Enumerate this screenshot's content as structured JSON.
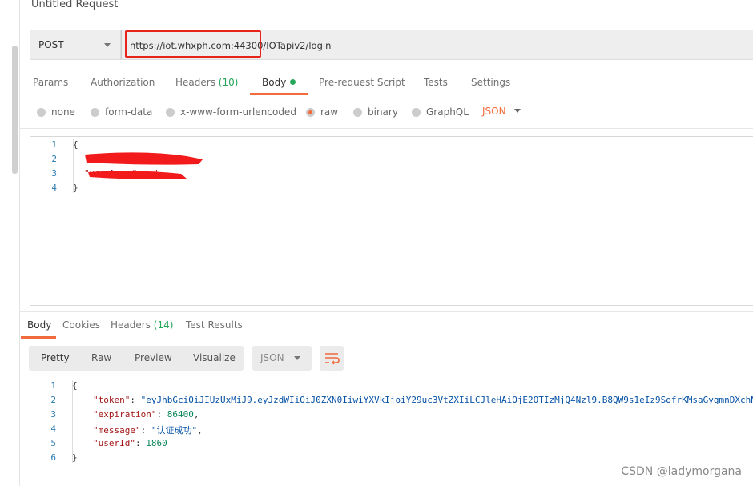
{
  "title": "Untitled Request",
  "request": {
    "method": "POST",
    "url": "https://iot.whxph.com:44300/IOTapiv2/login"
  },
  "request_tabs": [
    {
      "label": "Params"
    },
    {
      "label": "Authorization"
    },
    {
      "label": "Headers",
      "count": "(10)"
    },
    {
      "label": "Body",
      "active": true
    },
    {
      "label": "Pre-request Script"
    },
    {
      "label": "Tests"
    },
    {
      "label": "Settings"
    }
  ],
  "body_types": [
    {
      "label": "none"
    },
    {
      "label": "form-data"
    },
    {
      "label": "x-www-form-urlencoded"
    },
    {
      "label": "raw",
      "selected": true
    },
    {
      "label": "binary"
    },
    {
      "label": "GraphQL"
    }
  ],
  "body_format": "JSON",
  "request_body": {
    "lines": [
      "{",
      "",
      "\"userName\" : \"",
      "}"
    ]
  },
  "response_tabs": [
    {
      "label": "Body",
      "active": true
    },
    {
      "label": "Cookies"
    },
    {
      "label": "Headers",
      "count": "(14)"
    },
    {
      "label": "Test Results"
    }
  ],
  "response_view": {
    "modes": [
      "Pretty",
      "Raw",
      "Preview",
      "Visualize"
    ],
    "active": "Pretty",
    "format": "JSON",
    "wrap_icon": "wrap-lines-icon"
  },
  "response_body": {
    "token": "eyJhbGciOiJIUzUxMiJ9.eyJzdWIiOiJ0ZXN0IiwiYXVkIjoiY29uc3VtZXIiLCJleHAiOjE2OTIzMjQ4Nzl9.B8QW9s1eIz9SofrKMsaGygmnDXchN",
    "expiration": "86400",
    "message": "认证成功",
    "userId": "1860"
  },
  "colors": {
    "accent": "#f26b3a",
    "green": "#26a65b",
    "highlight": "#e8231c"
  },
  "watermark": "CSDN @ladymorgana"
}
